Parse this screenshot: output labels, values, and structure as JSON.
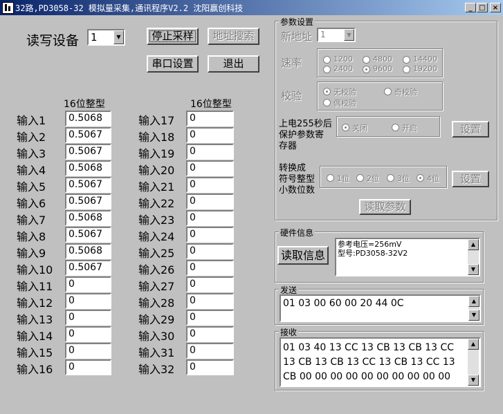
{
  "window": {
    "title": "32路,PD3058-32 模拟量采集,通讯程序V2.2  沈阳赢创科技",
    "minimize": "_",
    "maximize": "□",
    "close": "×"
  },
  "device": {
    "label": "读写设备",
    "value": "1"
  },
  "buttons": {
    "stop": "停止采样",
    "search": "地址搜索",
    "serial": "串口设置",
    "exit": "退出"
  },
  "columns": {
    "left_header": "16位整型",
    "right_header": "16位整型"
  },
  "inputs_left": [
    {
      "label": "输入1",
      "value": "0.5068"
    },
    {
      "label": "输入2",
      "value": "0.5067"
    },
    {
      "label": "输入3",
      "value": "0.5067"
    },
    {
      "label": "输入4",
      "value": "0.5068"
    },
    {
      "label": "输入5",
      "value": "0.5067"
    },
    {
      "label": "输入6",
      "value": "0.5067"
    },
    {
      "label": "输入7",
      "value": "0.5068"
    },
    {
      "label": "输入8",
      "value": "0.5067"
    },
    {
      "label": "输入9",
      "value": "0.5068"
    },
    {
      "label": "输入10",
      "value": "0.5067"
    },
    {
      "label": "输入11",
      "value": "0"
    },
    {
      "label": "输入12",
      "value": "0"
    },
    {
      "label": "输入13",
      "value": "0"
    },
    {
      "label": "输入14",
      "value": "0"
    },
    {
      "label": "输入15",
      "value": "0"
    },
    {
      "label": "输入16",
      "value": "0"
    }
  ],
  "inputs_right": [
    {
      "label": "输入17",
      "value": "0"
    },
    {
      "label": "输入18",
      "value": "0"
    },
    {
      "label": "输入19",
      "value": "0"
    },
    {
      "label": "输入20",
      "value": "0"
    },
    {
      "label": "输入21",
      "value": "0"
    },
    {
      "label": "输入22",
      "value": "0"
    },
    {
      "label": "输入23",
      "value": "0"
    },
    {
      "label": "输入24",
      "value": "0"
    },
    {
      "label": "输入25",
      "value": "0"
    },
    {
      "label": "输入26",
      "value": "0"
    },
    {
      "label": "输入27",
      "value": "0"
    },
    {
      "label": "输入28",
      "value": "0"
    },
    {
      "label": "输入29",
      "value": "0"
    },
    {
      "label": "输入30",
      "value": "0"
    },
    {
      "label": "输入31",
      "value": "0"
    },
    {
      "label": "输入32",
      "value": "0"
    }
  ],
  "params": {
    "title": "参数设置",
    "new_addr_label": "新地址",
    "new_addr_value": "1",
    "baud_label": "速率",
    "baud_options": [
      "1200",
      "4800",
      "14400",
      "2400",
      "9600",
      "19200"
    ],
    "baud_selected": "9600",
    "parity_label": "校验",
    "parity_options": [
      "无校验",
      "奇校验",
      "偶校验"
    ],
    "parity_selected": "无校验",
    "protect_label_1": "上电255秒后",
    "protect_label_2": "保护参数寄",
    "protect_label_3": "存器",
    "protect_options": [
      "关闭",
      "开启"
    ],
    "protect_selected": "关闭",
    "protect_set": "设置",
    "decimal_label_1": "转换成",
    "decimal_label_2": "符号整型",
    "decimal_label_3": "小数位数",
    "decimal_options": [
      "1位",
      "2位",
      "3位",
      "4位"
    ],
    "decimal_selected": "4位",
    "decimal_set": "设置",
    "read_params": "读取参数"
  },
  "hardware": {
    "title": "硬件信息",
    "read_button": "读取信息",
    "line1": "参考电压=256mV",
    "line2": "型号:PD3058-32V2"
  },
  "send": {
    "title": "发送",
    "text": "01 03 00 60 00 20 44 0C"
  },
  "receive": {
    "title": "接收",
    "line1": "01 03 40 13 CC 13 CB 13 CB 13 CC",
    "line2": "13 CB 13 CB 13 CC 13 CB 13 CC 13",
    "line3": "CB 00 00 00 00 00 00 00 00 00 00"
  },
  "icons": {
    "scroll_up": "▲",
    "scroll_down": "▼",
    "combo": "▼"
  }
}
